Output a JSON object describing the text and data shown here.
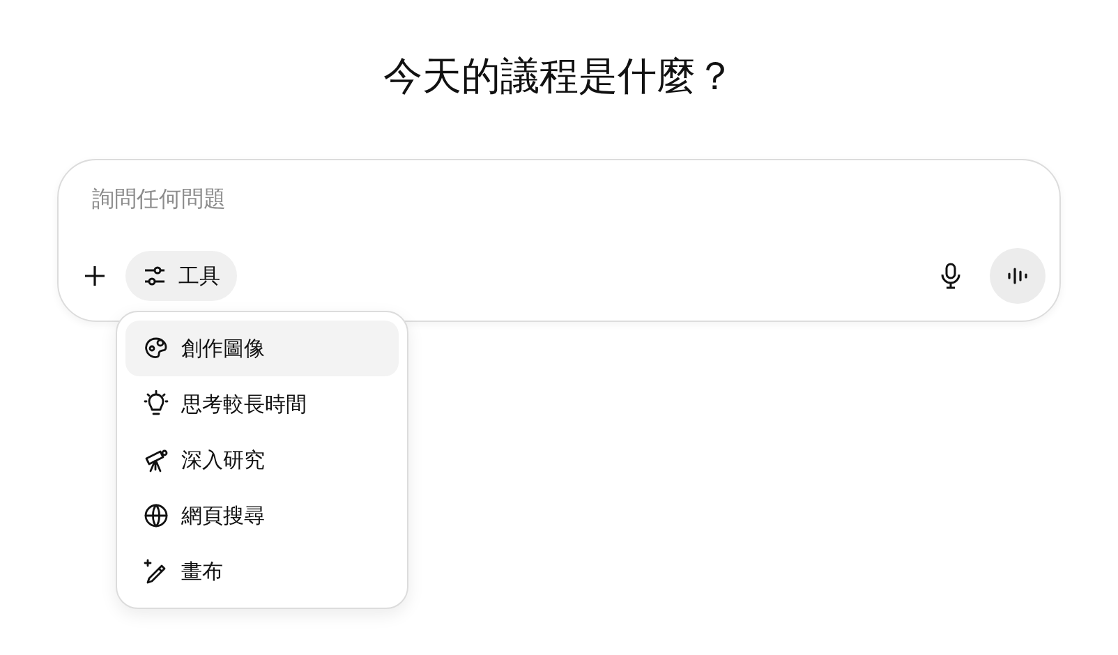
{
  "heading": "今天的議程是什麼？",
  "composer": {
    "placeholder": "詢問任何問題",
    "tools_label": "工具"
  },
  "menu": [
    {
      "kind": "image",
      "label": "創作圖像",
      "selected": true
    },
    {
      "kind": "think",
      "label": "思考較長時間",
      "selected": false
    },
    {
      "kind": "research",
      "label": "深入研究",
      "selected": false
    },
    {
      "kind": "web",
      "label": "網頁搜尋",
      "selected": false
    },
    {
      "kind": "canvas",
      "label": "畫布",
      "selected": false
    }
  ]
}
